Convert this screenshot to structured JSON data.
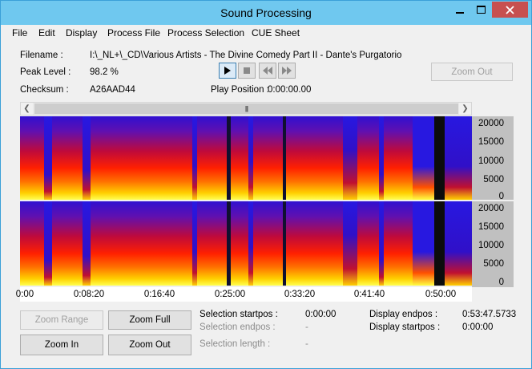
{
  "window": {
    "title": "Sound Processing"
  },
  "menu": [
    "File",
    "Edit",
    "Display",
    "Process File",
    "Process Selection",
    "CUE Sheet"
  ],
  "info": {
    "filename_label": "Filename :",
    "filename_value": "I:\\_NL+\\_CD\\Various Artists - The Divine Comedy Part II - Dante's Purgatorio",
    "peak_label": "Peak Level :",
    "peak_value": "98.2 %",
    "checksum_label": "Checksum :",
    "checksum_value": "A26AAD44",
    "play_position_label": "Play Position :",
    "play_position_value": "0:00:00.00"
  },
  "transport": [
    "play-icon",
    "stop-icon",
    "rewind-icon",
    "fast-forward-icon"
  ],
  "zoom_out_top": "Zoom Out",
  "frequency_ticks": [
    "20000",
    "15000",
    "10000",
    "5000",
    "0"
  ],
  "time_ticks": [
    "0:00",
    "0:08:20",
    "0:16:40",
    "0:25:00",
    "0:33:20",
    "0:41:40",
    "0:50:00"
  ],
  "buttons": {
    "zoom_range": "Zoom Range",
    "zoom_full": "Zoom Full",
    "zoom_in": "Zoom In",
    "zoom_out": "Zoom Out"
  },
  "selection": {
    "startpos_label": "Selection startpos :",
    "startpos_value": "0:00:00",
    "endpos_label": "Selection endpos :",
    "endpos_value": "-",
    "length_label": "Selection length :",
    "length_value": "-"
  },
  "display": {
    "endpos_label": "Display endpos :",
    "endpos_value": "0:53:47.5733",
    "startpos_label": "Display startpos :",
    "startpos_value": "0:00:00"
  }
}
